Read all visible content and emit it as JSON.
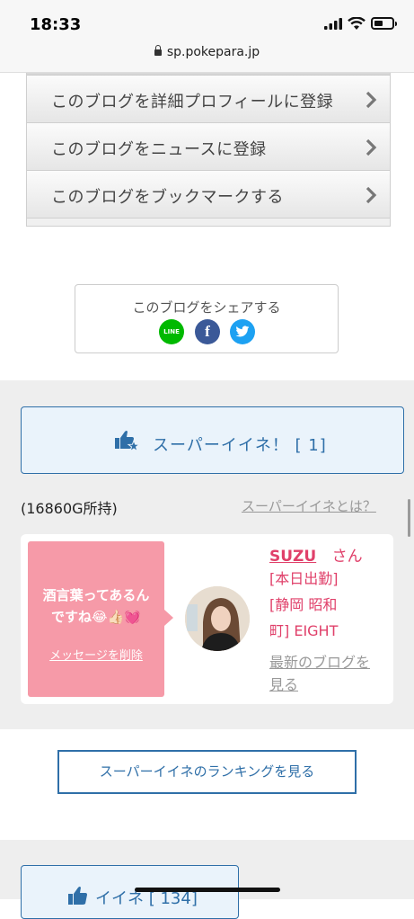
{
  "status_bar": {
    "time": "18:33",
    "url": "sp.pokepara.jp"
  },
  "menu": {
    "items": [
      {
        "label": "このブログを詳細プロフィールに登録"
      },
      {
        "label": "このブログをニュースに登録"
      },
      {
        "label": "このブログをブックマークする"
      }
    ]
  },
  "share": {
    "title": "このブログをシェアする",
    "line_label": "LINE",
    "facebook_label": "f"
  },
  "super_iine": {
    "button_label": "スーパーイイネ！ [ 1]",
    "points": "(16860G所持)",
    "what_link": "スーパーイイネとは？"
  },
  "message_card": {
    "message_line1": "酒言葉ってあるん",
    "message_line2": "ですね😂👍🏻💓",
    "delete_label": "メッセージを削除",
    "cast_name": "SUZU",
    "honorific": "さん",
    "shop_line1": "[本日出勤]",
    "shop_line2": "[静岡 昭和",
    "shop_line3": "町] EIGHT",
    "latest_blog_line1": "最新のブログを",
    "latest_blog_line2": "見る"
  },
  "ranking": {
    "button_label": "スーパーイイネのランキングを見る"
  },
  "iine": {
    "button_label": "イイネ [ 134]"
  },
  "colors": {
    "accent_blue": "#2f6fa8",
    "pink": "#e0406a",
    "bubble": "#f69aa8"
  }
}
